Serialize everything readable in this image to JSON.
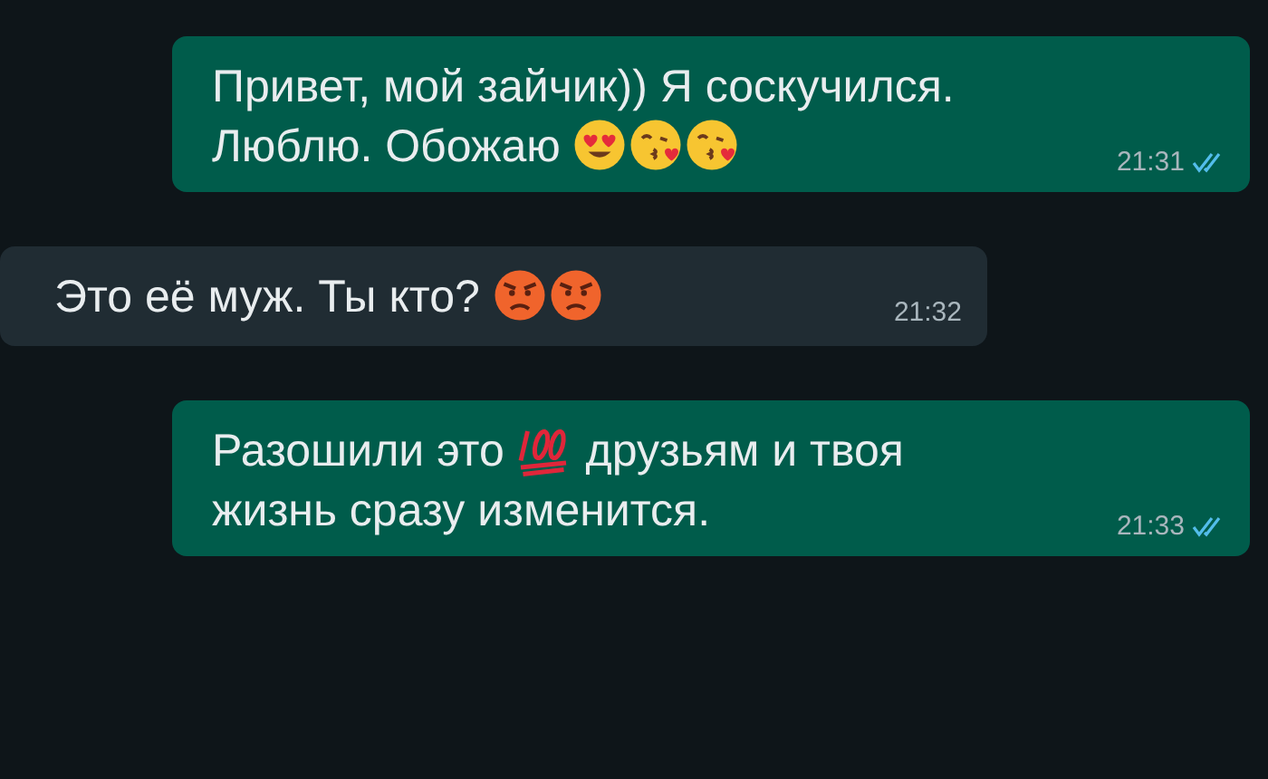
{
  "messages": [
    {
      "outgoing": true,
      "parts": [
        {
          "text": "Привет, мой зайчик)) Я соскучился.\nЛюблю. Обожаю "
        },
        {
          "kind": "heart-eyes"
        },
        {
          "kind": "kiss"
        },
        {
          "kind": "kiss"
        }
      ],
      "time": "21:31",
      "read": true
    },
    {
      "outgoing": false,
      "parts": [
        {
          "text": "Это её муж. Ты кто? "
        },
        {
          "kind": "angry"
        },
        {
          "kind": "angry"
        }
      ],
      "time": "21:32"
    },
    {
      "outgoing": true,
      "parts": [
        {
          "text": "Разошили это "
        },
        {
          "kind": "hundred"
        },
        {
          "text": " друзьям и твоя\nжизнь сразу изменится."
        }
      ],
      "time": "21:33",
      "read": true
    }
  ]
}
